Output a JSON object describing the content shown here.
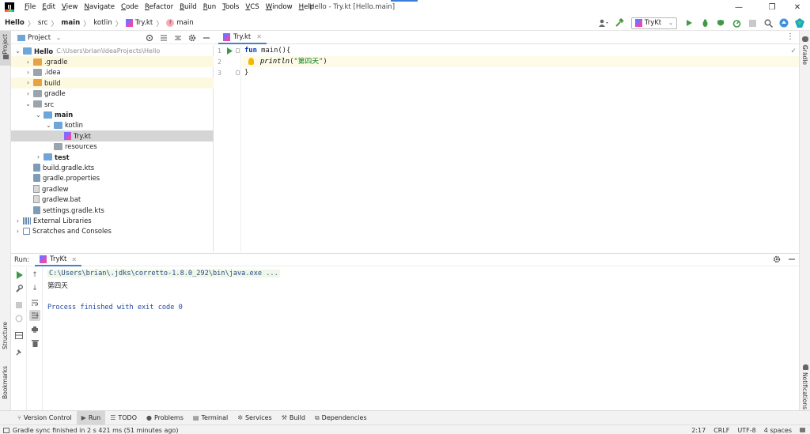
{
  "window": {
    "title": "Hello - Try.kt [Hello.main]",
    "controls": {
      "minimize": "—",
      "maximize": "❐",
      "close": "✕"
    }
  },
  "menu": [
    {
      "u": "F",
      "rest": "ile"
    },
    {
      "u": "E",
      "rest": "dit"
    },
    {
      "u": "V",
      "rest": "iew"
    },
    {
      "u": "N",
      "rest": "avigate"
    },
    {
      "u": "C",
      "rest": "ode"
    },
    {
      "u": "R",
      "rest": "efactor"
    },
    {
      "u": "B",
      "rest": "uild"
    },
    {
      "u": "R",
      "rest": "un"
    },
    {
      "u": "T",
      "rest": "ools"
    },
    {
      "u": "V",
      "rest": "CS"
    },
    {
      "u": "W",
      "rest": "indow"
    },
    {
      "u": "H",
      "rest": "elp"
    }
  ],
  "breadcrumb": [
    "Hello",
    "src",
    "main",
    "kotlin",
    "Try.kt",
    "main"
  ],
  "run_config": {
    "label": "TryKt"
  },
  "project_panel": {
    "title": "Project",
    "tree": [
      {
        "label": "Hello",
        "hint": "C:\\Users\\brian\\IdeaProjects\\Hello",
        "depth": 0,
        "chev": "⌄",
        "icon": "folder-blue",
        "bold": true,
        "state": ""
      },
      {
        "label": ".gradle",
        "depth": 1,
        "chev": "›",
        "icon": "folder-orange",
        "state": "hl"
      },
      {
        "label": ".idea",
        "depth": 1,
        "chev": "›",
        "icon": "folder-grey",
        "state": ""
      },
      {
        "label": "build",
        "depth": 1,
        "chev": "›",
        "icon": "folder-orange",
        "state": "hl"
      },
      {
        "label": "gradle",
        "depth": 1,
        "chev": "›",
        "icon": "folder-grey",
        "state": ""
      },
      {
        "label": "src",
        "depth": 1,
        "chev": "⌄",
        "icon": "folder-grey",
        "state": ""
      },
      {
        "label": "main",
        "depth": 2,
        "chev": "⌄",
        "icon": "folder-blue",
        "bold": true,
        "state": ""
      },
      {
        "label": "kotlin",
        "depth": 3,
        "chev": "⌄",
        "icon": "folder-blue",
        "state": ""
      },
      {
        "label": "Try.kt",
        "depth": 4,
        "chev": "",
        "icon": "file-kt",
        "state": "sel"
      },
      {
        "label": "resources",
        "depth": 3,
        "chev": "",
        "icon": "folder-grey",
        "state": ""
      },
      {
        "label": "test",
        "depth": 2,
        "chev": "›",
        "icon": "folder-blue",
        "bold": true,
        "state": ""
      },
      {
        "label": "build.gradle.kts",
        "depth": 1,
        "chev": "",
        "icon": "file-gradle",
        "state": ""
      },
      {
        "label": "gradle.properties",
        "depth": 1,
        "chev": "",
        "icon": "file-gradle",
        "state": ""
      },
      {
        "label": "gradlew",
        "depth": 1,
        "chev": "",
        "icon": "file-doc",
        "state": ""
      },
      {
        "label": "gradlew.bat",
        "depth": 1,
        "chev": "",
        "icon": "file-doc",
        "state": ""
      },
      {
        "label": "settings.gradle.kts",
        "depth": 1,
        "chev": "",
        "icon": "file-gradle",
        "state": ""
      },
      {
        "label": "External Libraries",
        "depth": 0,
        "chev": "›",
        "icon": "lib-icon",
        "state": ""
      },
      {
        "label": "Scratches and Consoles",
        "depth": 0,
        "chev": "›",
        "icon": "scratch-icon",
        "state": ""
      }
    ]
  },
  "editor": {
    "tab": "Try.kt",
    "line_numbers": [
      "1",
      "2",
      "3"
    ],
    "code": {
      "l1_kw": "fun",
      "l1_rest": " main(){",
      "l2_fn": "println",
      "l2_open": "(",
      "l2_str": "\"第四天\"",
      "l2_close": ")",
      "l3": "}"
    }
  },
  "run_panel": {
    "label": "Run:",
    "tab": "TryKt",
    "console": {
      "command": "C:\\Users\\brian\\.jdks\\corretto-1.8.0_292\\bin\\java.exe ...",
      "output": "第四天",
      "exit": "Process finished with exit code 0"
    }
  },
  "left_stripe": {
    "project": "Project",
    "structure": "Structure",
    "bookmarks": "Bookmarks"
  },
  "right_stripe": {
    "gradle": "Gradle",
    "notifications": "Notifications"
  },
  "bottom_tabs": [
    "Version Control",
    "Run",
    "TODO",
    "Problems",
    "Terminal",
    "Services",
    "Build",
    "Dependencies"
  ],
  "status": {
    "message": "Gradle sync finished in 2 s 421 ms (51 minutes ago)",
    "position": "2:17",
    "line_sep": "CRLF",
    "encoding": "UTF-8",
    "indent": "4 spaces"
  },
  "colors": {
    "accent": "#4083c9",
    "keyword": "#0033b3",
    "string": "#067d17",
    "run_green": "#3f9a47"
  }
}
